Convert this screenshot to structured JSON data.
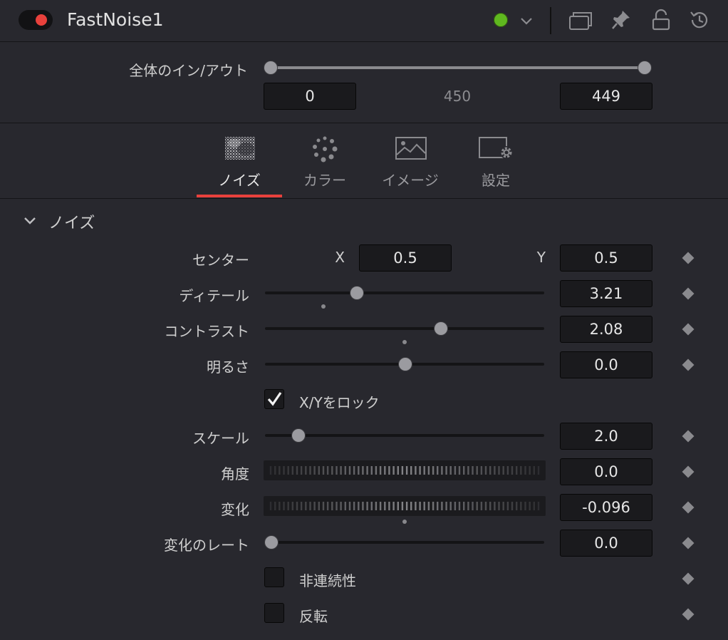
{
  "header": {
    "title": "FastNoise1",
    "icons": [
      "power-toggle",
      "status-dot",
      "chevron-down-icon",
      "windows-icon",
      "pin-icon",
      "lock-icon",
      "reset-icon"
    ],
    "status_color": "#5fb81f",
    "accent_color": "#e8413c"
  },
  "inout": {
    "label": "全体のイン/アウト",
    "in_value": "0",
    "duration": "450",
    "out_value": "449"
  },
  "tabs": [
    {
      "label": "ノイズ",
      "active": true
    },
    {
      "label": "カラー",
      "active": false
    },
    {
      "label": "イメージ",
      "active": false
    },
    {
      "label": "設定",
      "active": false
    }
  ],
  "section": {
    "title": "ノイズ",
    "center": {
      "label": "センター",
      "x_label": "X",
      "x_value": "0.5",
      "y_label": "Y",
      "y_value": "0.5"
    },
    "detail": {
      "label": "ディテール",
      "value": "3.21"
    },
    "contrast": {
      "label": "コントラスト",
      "value": "2.08"
    },
    "brightness": {
      "label": "明るさ",
      "value": "0.0"
    },
    "lock_xy": {
      "label": "X/Yをロック",
      "checked": true
    },
    "scale": {
      "label": "スケール",
      "value": "2.0"
    },
    "angle": {
      "label": "角度",
      "value": "0.0"
    },
    "variation": {
      "label": "変化",
      "value": "-0.096"
    },
    "variation_rate": {
      "label": "変化のレート",
      "value": "0.0"
    },
    "discontinuous": {
      "label": "非連続性",
      "checked": false
    },
    "invert": {
      "label": "反転",
      "checked": false
    }
  }
}
